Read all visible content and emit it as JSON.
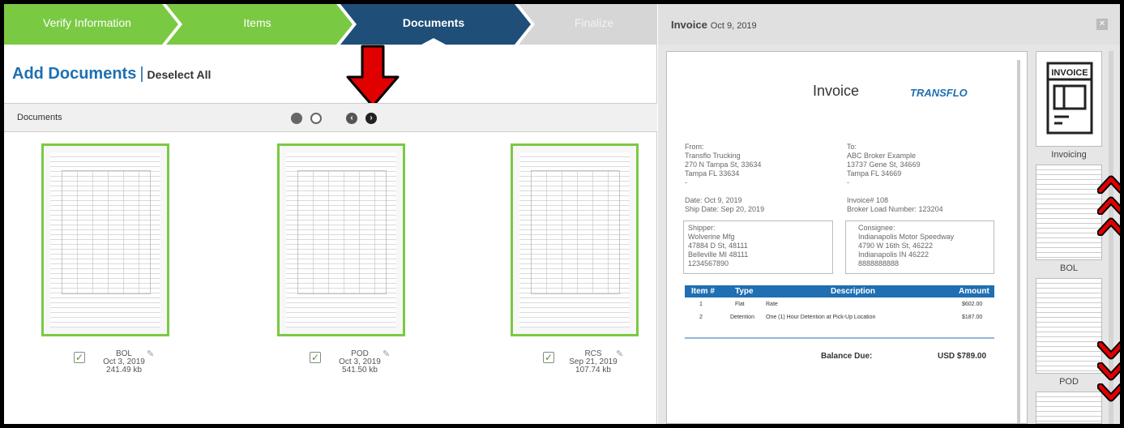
{
  "stepper": {
    "steps": [
      {
        "label": "Verify Information",
        "color": "#7ac943"
      },
      {
        "label": "Items",
        "color": "#7ac943"
      },
      {
        "label": "Documents",
        "color": "#1f4e79"
      },
      {
        "label": "Finalize",
        "color": "#d6d6d6"
      }
    ]
  },
  "left": {
    "heading": "Add Documents",
    "separator": "|",
    "deselect_label": "Deselect All",
    "docs_bar_label": "Documents",
    "pager": {
      "pages": 2,
      "current": 1
    }
  },
  "documents": [
    {
      "name": "BOL",
      "date": "Oct 3, 2019",
      "size": "241.49 kb",
      "checked": true
    },
    {
      "name": "POD",
      "date": "Oct 3, 2019",
      "size": "541.50 kb",
      "checked": true
    },
    {
      "name": "RCS",
      "date": "Sep 21, 2019",
      "size": "107.74 kb",
      "checked": true
    }
  ],
  "preview": {
    "header_title": "Invoice",
    "header_date": "Oct 9, 2019",
    "invoice": {
      "title": "Invoice",
      "logo": "TRANSFLO",
      "from": "From:\nTransflo Trucking\n270 N Tampa St, 33634\nTampa FL 33634\n-",
      "to": "To:\nABC Broker Example\n13737 Gene St, 34669\nTampa FL 34669\n-",
      "dates": "Date: Oct 9, 2019\nShip Date: Sep 20, 2019",
      "invoice_info": "Invoice# 108\nBroker Load Number: 123204",
      "shipper": "Shipper:\nWolverine Mfg\n47884 D St, 48111\nBelleville MI 48111\n1234567890",
      "consignee": "Consignee:\nIndianapolis Motor Speedway\n4790 W 16th St, 46222\nIndianapolis IN 46222\n8888888888",
      "table_headers": [
        "Item #",
        "Type",
        "Description",
        "Amount"
      ],
      "rows": [
        {
          "item": "1",
          "type": "Flat",
          "description": "Rate",
          "amount": "$602.00"
        },
        {
          "item": "2",
          "type": "Detention",
          "description": "One (1) Hour Detention at Pick-Up Location",
          "amount": "$187.00"
        }
      ],
      "balance_label": "Balance Due:",
      "balance_value": "USD $789.00"
    }
  },
  "side_thumbs": [
    {
      "label": "Invoicing",
      "icon_text": "INVOICE"
    },
    {
      "label": "BOL"
    },
    {
      "label": "POD"
    }
  ],
  "annotation_colors": {
    "red_arrow": "#e00000",
    "chevron_red": "#e00000"
  }
}
